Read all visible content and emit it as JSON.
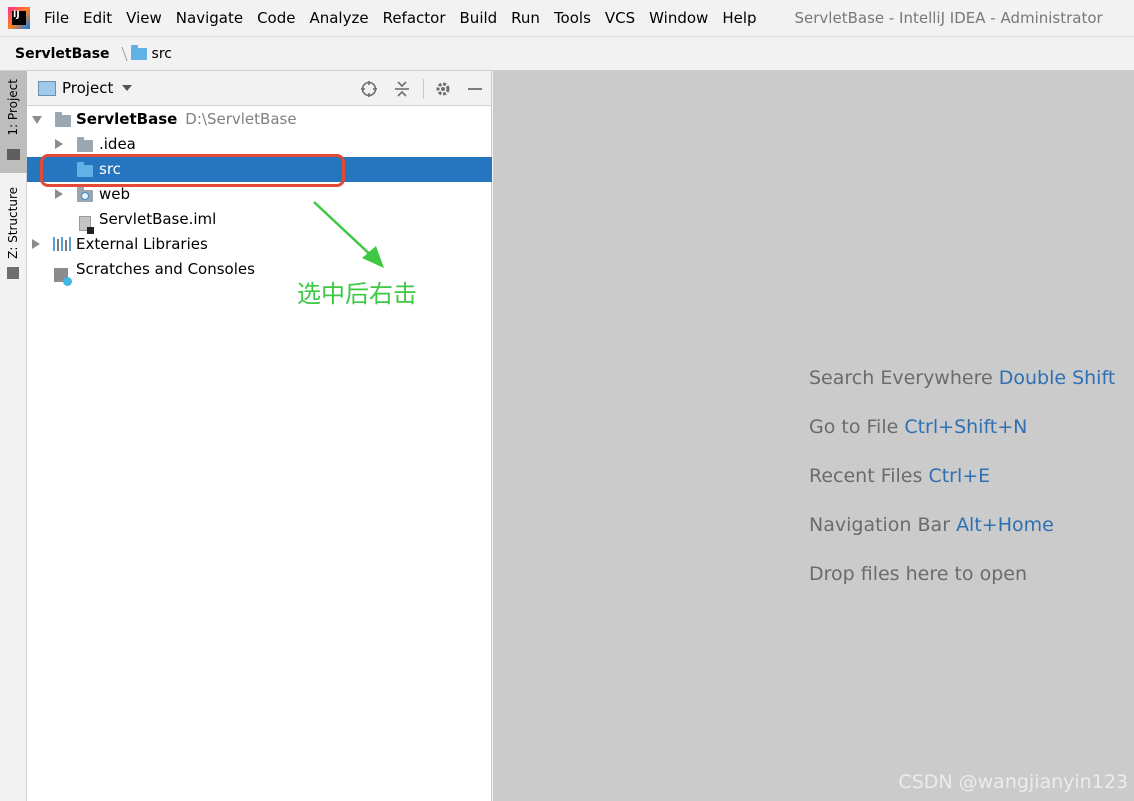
{
  "app": {
    "logo_text": "IJ",
    "window_title": "ServletBase - IntelliJ IDEA - Administrator"
  },
  "menu": [
    "File",
    "Edit",
    "View",
    "Navigate",
    "Code",
    "Analyze",
    "Refactor",
    "Build",
    "Run",
    "Tools",
    "VCS",
    "Window",
    "Help"
  ],
  "navbar": {
    "project": "ServletBase",
    "folder": "src"
  },
  "toolstrip": {
    "project_tab": "1: Project",
    "structure_tab": "Z: Structure"
  },
  "panel": {
    "title": "Project",
    "tree": [
      {
        "label": "ServletBase",
        "path": "D:\\ServletBase",
        "expanded": true,
        "level": 0
      },
      {
        "label": ".idea",
        "level": 1
      },
      {
        "label": "src",
        "level": 1,
        "selected": true
      },
      {
        "label": "web",
        "level": 1
      },
      {
        "label": "ServletBase.iml",
        "level": 1
      },
      {
        "label": "External Libraries",
        "level": 0
      },
      {
        "label": "Scratches and Consoles",
        "level": 0
      }
    ]
  },
  "annotation": {
    "text": "选中后右击",
    "color": "#3ec845",
    "box_color": "#e34a35"
  },
  "editor": {
    "hints": [
      {
        "text": "Search Everywhere",
        "key": "Double Shift"
      },
      {
        "text": "Go to File",
        "key": "Ctrl+Shift+N"
      },
      {
        "text": "Recent Files",
        "key": "Ctrl+E"
      },
      {
        "text": "Navigation Bar",
        "key": "Alt+Home"
      },
      {
        "text": "Drop files here to open",
        "key": ""
      }
    ]
  },
  "watermark": "CSDN @wangjianyin123",
  "colors": {
    "selection": "#2675bf",
    "hint_key": "#2f6fb3",
    "folder_blue": "#62b1e6"
  }
}
